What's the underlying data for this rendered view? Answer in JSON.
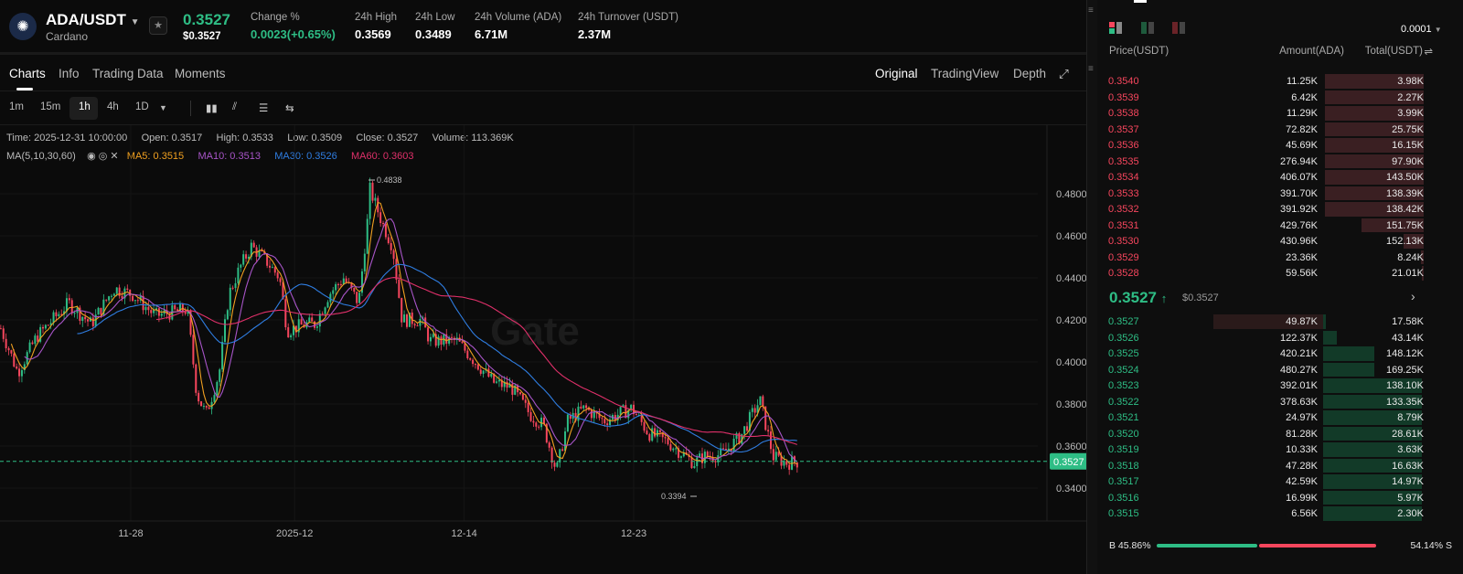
{
  "header": {
    "pair": "ADA/USDT",
    "name": "Cardano",
    "price": "0.3527",
    "price_usd": "$0.3527",
    "stats": [
      {
        "label": "Change %",
        "value": "0.0023(+0.65%)",
        "green": true
      },
      {
        "label": "24h High",
        "value": "0.3569"
      },
      {
        "label": "24h Low",
        "value": "0.3489"
      },
      {
        "label": "24h Volume (ADA)",
        "value": "6.71M"
      },
      {
        "label": "24h Turnover (USDT)",
        "value": "2.37M"
      }
    ]
  },
  "tabs": [
    "Charts",
    "Info",
    "Trading Data",
    "Moments"
  ],
  "view_tabs": [
    "Original",
    "TradingView",
    "Depth"
  ],
  "timeframes": [
    "1m",
    "15m",
    "1h",
    "4h",
    "1D"
  ],
  "active_timeframe": "1h",
  "ohlc": {
    "time": "Time: 2025-12-31 10:00:00",
    "open": "Open: 0.3517",
    "high": "High: 0.3533",
    "low": "Low: 0.3509",
    "close": "Close: 0.3527",
    "volume": "Volume: 113.369K"
  },
  "ma": {
    "label": "MA(5,10,30,60)",
    "ma5": "MA5: 0.3515",
    "ma10": "MA10: 0.3513",
    "ma30": "MA30: 0.3526",
    "ma60": "MA60: 0.3603"
  },
  "colors": {
    "up": "#2ebd85",
    "down": "#f6465d",
    "ma5": "#f0a020",
    "ma10": "#a855c8",
    "ma30": "#2f7de1",
    "ma60": "#e0306a"
  },
  "chart": {
    "watermark": "Gate",
    "y_ticks": [
      "0.4800",
      "0.4600",
      "0.4400",
      "0.4200",
      "0.4000",
      "0.3800",
      "0.3600",
      "0.3400"
    ],
    "x_ticks": [
      "11-28",
      "2025-12",
      "12-14",
      "12-23"
    ],
    "max_label": "0.4838",
    "min_label": "0.3394",
    "last_price": "0.3527",
    "price_path": [
      [
        -6.9,
        0.416
      ],
      [
        -6.0,
        0.395
      ],
      [
        -5.0,
        0.412
      ],
      [
        -3.3,
        0.428
      ],
      [
        -2.1,
        0.418
      ],
      [
        -0.9,
        0.435
      ],
      [
        0.1,
        0.432
      ],
      [
        1.3,
        0.422
      ],
      [
        3.0,
        0.425
      ],
      [
        3.5,
        0.385
      ],
      [
        4.0,
        0.375
      ],
      [
        4.7,
        0.395
      ],
      [
        5.2,
        0.432
      ],
      [
        5.8,
        0.445
      ],
      [
        6.4,
        0.455
      ],
      [
        7.2,
        0.448
      ],
      [
        7.9,
        0.44
      ],
      [
        8.3,
        0.415
      ],
      [
        9.3,
        0.418
      ],
      [
        9.8,
        0.418
      ],
      [
        10.5,
        0.432
      ],
      [
        11.3,
        0.44
      ],
      [
        12.1,
        0.428
      ],
      [
        12.6,
        0.47
      ],
      [
        12.7,
        0.482
      ],
      [
        13.4,
        0.465
      ],
      [
        13.9,
        0.455
      ],
      [
        14.4,
        0.42
      ],
      [
        15.4,
        0.42
      ],
      [
        15.9,
        0.41
      ],
      [
        17.3,
        0.41
      ],
      [
        18.3,
        0.4
      ],
      [
        19.3,
        0.39
      ],
      [
        20.2,
        0.388
      ],
      [
        21.2,
        0.375
      ],
      [
        21.9,
        0.37
      ],
      [
        22.6,
        0.348
      ],
      [
        23.2,
        0.372
      ],
      [
        24.1,
        0.378
      ],
      [
        25.1,
        0.372
      ],
      [
        26.6,
        0.378
      ],
      [
        27.5,
        0.366
      ],
      [
        28.5,
        0.362
      ],
      [
        29.9,
        0.352
      ],
      [
        30.4,
        0.355
      ],
      [
        31.4,
        0.356
      ],
      [
        32.4,
        0.365
      ],
      [
        33.4,
        0.382
      ],
      [
        34.1,
        0.355
      ],
      [
        34.8,
        0.352
      ],
      [
        35.5,
        0.3527
      ]
    ]
  },
  "orderbook": {
    "precision": "0.0001",
    "headers": [
      "Price(USDT)",
      "Amount(ADA)",
      "Total(USDT)"
    ],
    "asks": [
      [
        "0.3540",
        "11.25K",
        "3.98K",
        100
      ],
      [
        "0.3539",
        "6.42K",
        "2.27K",
        100
      ],
      [
        "0.3538",
        "11.29K",
        "3.99K",
        100
      ],
      [
        "0.3537",
        "72.82K",
        "25.75K",
        100
      ],
      [
        "0.3536",
        "45.69K",
        "16.15K",
        100
      ],
      [
        "0.3535",
        "276.94K",
        "97.90K",
        100
      ],
      [
        "0.3534",
        "406.07K",
        "143.50K",
        100
      ],
      [
        "0.3533",
        "391.70K",
        "138.39K",
        100
      ],
      [
        "0.3532",
        "391.92K",
        "138.42K",
        100
      ],
      [
        "0.3531",
        "429.76K",
        "151.75K",
        63
      ],
      [
        "0.3530",
        "430.96K",
        "152.13K",
        20
      ],
      [
        "0.3529",
        "23.36K",
        "8.24K",
        3
      ],
      [
        "0.3528",
        "59.56K",
        "21.01K",
        2
      ]
    ],
    "mid_price": "0.3527",
    "mid_usd": "$0.3527",
    "bids": [
      [
        "0.3527",
        "49.87K",
        "17.58K",
        3
      ],
      [
        "0.3526",
        "122.37K",
        "43.14K",
        14
      ],
      [
        "0.3525",
        "420.21K",
        "148.12K",
        52
      ],
      [
        "0.3524",
        "480.27K",
        "169.25K",
        52
      ],
      [
        "0.3523",
        "392.01K",
        "138.10K",
        100
      ],
      [
        "0.3522",
        "378.63K",
        "133.35K",
        100
      ],
      [
        "0.3521",
        "24.97K",
        "8.79K",
        100
      ],
      [
        "0.3520",
        "81.28K",
        "28.61K",
        100
      ],
      [
        "0.3519",
        "10.33K",
        "3.63K",
        100
      ],
      [
        "0.3518",
        "47.28K",
        "16.63K",
        100
      ],
      [
        "0.3517",
        "42.59K",
        "14.97K",
        100
      ],
      [
        "0.3516",
        "16.99K",
        "5.97K",
        100
      ],
      [
        "0.3515",
        "6.56K",
        "2.30K",
        100
      ]
    ],
    "buy_pct": "B 45.86%",
    "sell_pct": "54.14% S",
    "buy_ratio": 45.86
  }
}
